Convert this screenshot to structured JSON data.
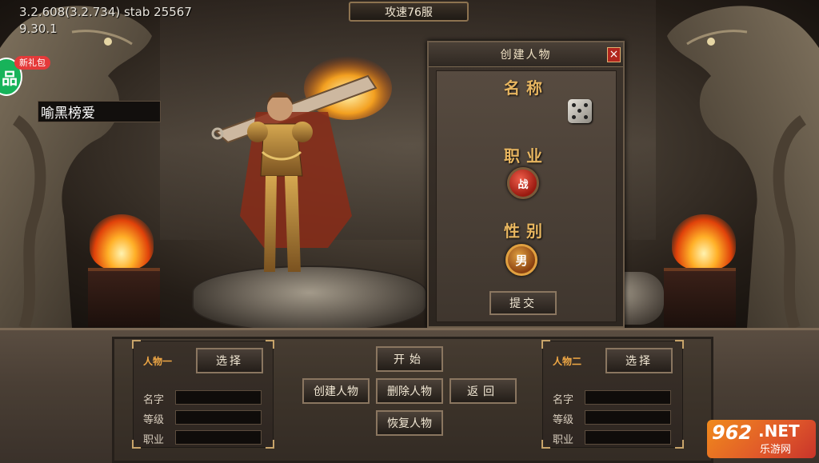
{
  "hud": {
    "version_line1": "3.2.608(3.2.734) stab 25567",
    "version_line2": "9.30.1",
    "gift_badge": "新礼包",
    "gift_icon_text": "品",
    "server_name": "攻速76服"
  },
  "create_dialog": {
    "title": "创建人物",
    "close_label": "×",
    "name_heading": "名称",
    "name_value": "喻黑榜爱",
    "class_heading": "职业",
    "class_value": "战",
    "gender_heading": "性别",
    "gender_value": "男",
    "submit_label": "提交"
  },
  "character_slots": [
    {
      "title": "人物一",
      "select_label": "选择",
      "fields": [
        "名字",
        "等级",
        "职业"
      ]
    },
    {
      "title": "人物二",
      "select_label": "选择",
      "fields": [
        "名字",
        "等级",
        "职业"
      ]
    }
  ],
  "actions": {
    "start": "开始",
    "create": "创建人物",
    "delete": "删除人物",
    "back": "返回",
    "restore": "恢复人物"
  },
  "watermark": {
    "number": "962",
    "domain": ".NET",
    "sub": "乐游网"
  },
  "colors": {
    "accent_gold": "#e8b660",
    "slot_title": "#f0a845",
    "close_red": "#b1261e",
    "gift_green": "#17b35a"
  }
}
